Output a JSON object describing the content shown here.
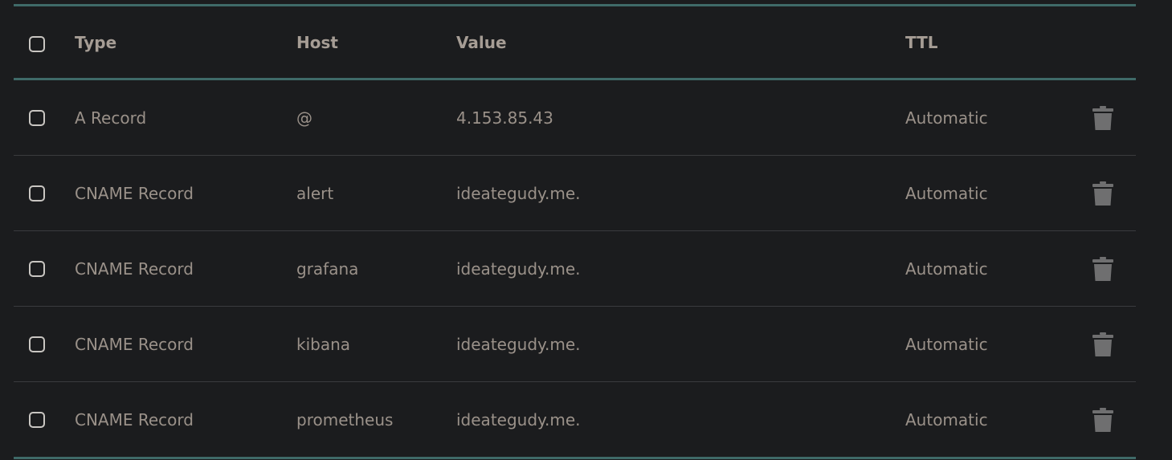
{
  "columns": {
    "type": "Type",
    "host": "Host",
    "value": "Value",
    "ttl": "TTL"
  },
  "records": [
    {
      "type": "A Record",
      "host": "@",
      "value": "4.153.85.43",
      "ttl": "Automatic"
    },
    {
      "type": "CNAME Record",
      "host": "alert",
      "value": "ideategudy.me.",
      "ttl": "Automatic"
    },
    {
      "type": "CNAME Record",
      "host": "grafana",
      "value": "ideategudy.me.",
      "ttl": "Automatic"
    },
    {
      "type": "CNAME Record",
      "host": "kibana",
      "value": "ideategudy.me.",
      "ttl": "Automatic"
    },
    {
      "type": "CNAME Record",
      "host": "prometheus",
      "value": "ideategudy.me.",
      "ttl": "Automatic"
    }
  ],
  "colors": {
    "accent_rule": "#3f6a68",
    "background": "#1b1c1e",
    "text": "#9a9189",
    "icon": "#6f6f70"
  },
  "icons": {
    "row_action": "trash-icon",
    "select": "checkbox"
  }
}
